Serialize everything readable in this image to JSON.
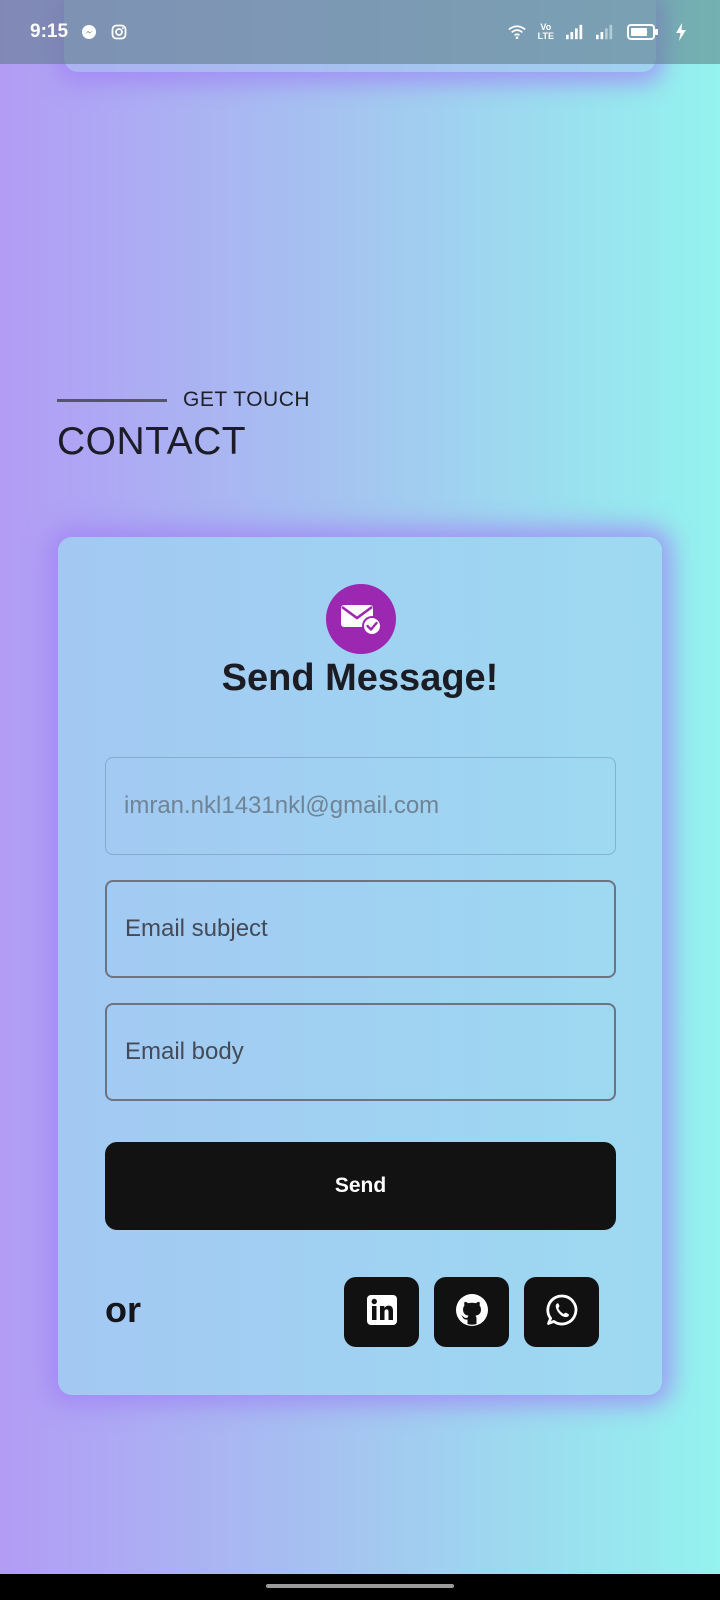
{
  "status_bar": {
    "time": "9:15",
    "left_icons": [
      "messenger-icon",
      "instagram-icon"
    ],
    "right_icons": [
      "wifi-icon",
      "volte-icon",
      "signal-1-icon",
      "signal-2-icon",
      "battery-icon",
      "charging-icon"
    ],
    "volte_label_top": "Vo",
    "volte_label_bottom": "LTE"
  },
  "section": {
    "subtitle": "GET TOUCH",
    "title": "CONTACT"
  },
  "card": {
    "icon": "mail-check-icon",
    "title": "Send Message!",
    "email_field": {
      "placeholder": "imran.nkl1431nkl@gmail.com",
      "value": ""
    },
    "subject_field": {
      "placeholder": "Email subject",
      "value": ""
    },
    "body_field": {
      "placeholder": "Email body",
      "value": ""
    },
    "send_label": "Send",
    "or_label": "or",
    "socials": [
      {
        "name": "LinkedIn",
        "icon": "linkedin-icon"
      },
      {
        "name": "GitHub",
        "icon": "github-icon"
      },
      {
        "name": "WhatsApp",
        "icon": "whatsapp-icon"
      }
    ]
  },
  "colors": {
    "accent": "#9c27b0",
    "button": "#121212",
    "gradient_left": "#b29cf5",
    "gradient_right": "#93f3ee"
  }
}
